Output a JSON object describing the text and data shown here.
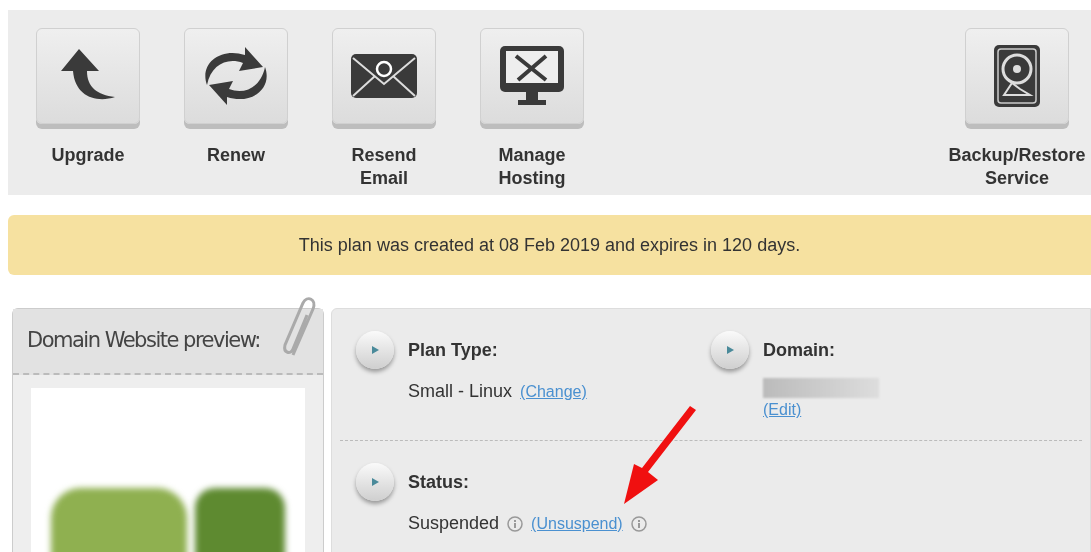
{
  "toolbar": {
    "buttons": [
      {
        "kind": "upgrade",
        "label": "Upgrade"
      },
      {
        "kind": "renew",
        "label": "Renew"
      },
      {
        "kind": "email",
        "label": "Resend Email"
      },
      {
        "kind": "manage",
        "label": "Manage Hosting"
      },
      {
        "kind": "backup",
        "label": "Backup/Restore Service"
      }
    ]
  },
  "notice": "This plan was created at 08 Feb 2019 and expires in 120 days.",
  "preview": {
    "title": "Domain Website preview:"
  },
  "details": {
    "rows": [
      [
        {
          "kind": "inline",
          "label": "Plan Type:",
          "parts": [
            {
              "kind": "text",
              "text": "Small - Linux"
            },
            {
              "kind": "link",
              "text": "(Change)"
            }
          ]
        },
        {
          "kind": "stacked",
          "label": "Domain:",
          "parts": [
            {
              "kind": "blurred"
            },
            {
              "kind": "link",
              "text": "(Edit)"
            }
          ]
        }
      ],
      [
        {
          "kind": "inline",
          "label": "Status:",
          "parts": [
            {
              "kind": "text",
              "text": "Suspended"
            },
            {
              "kind": "info"
            },
            {
              "kind": "link",
              "text": "(Unsuspend)"
            },
            {
              "kind": "info"
            }
          ]
        }
      ]
    ]
  }
}
